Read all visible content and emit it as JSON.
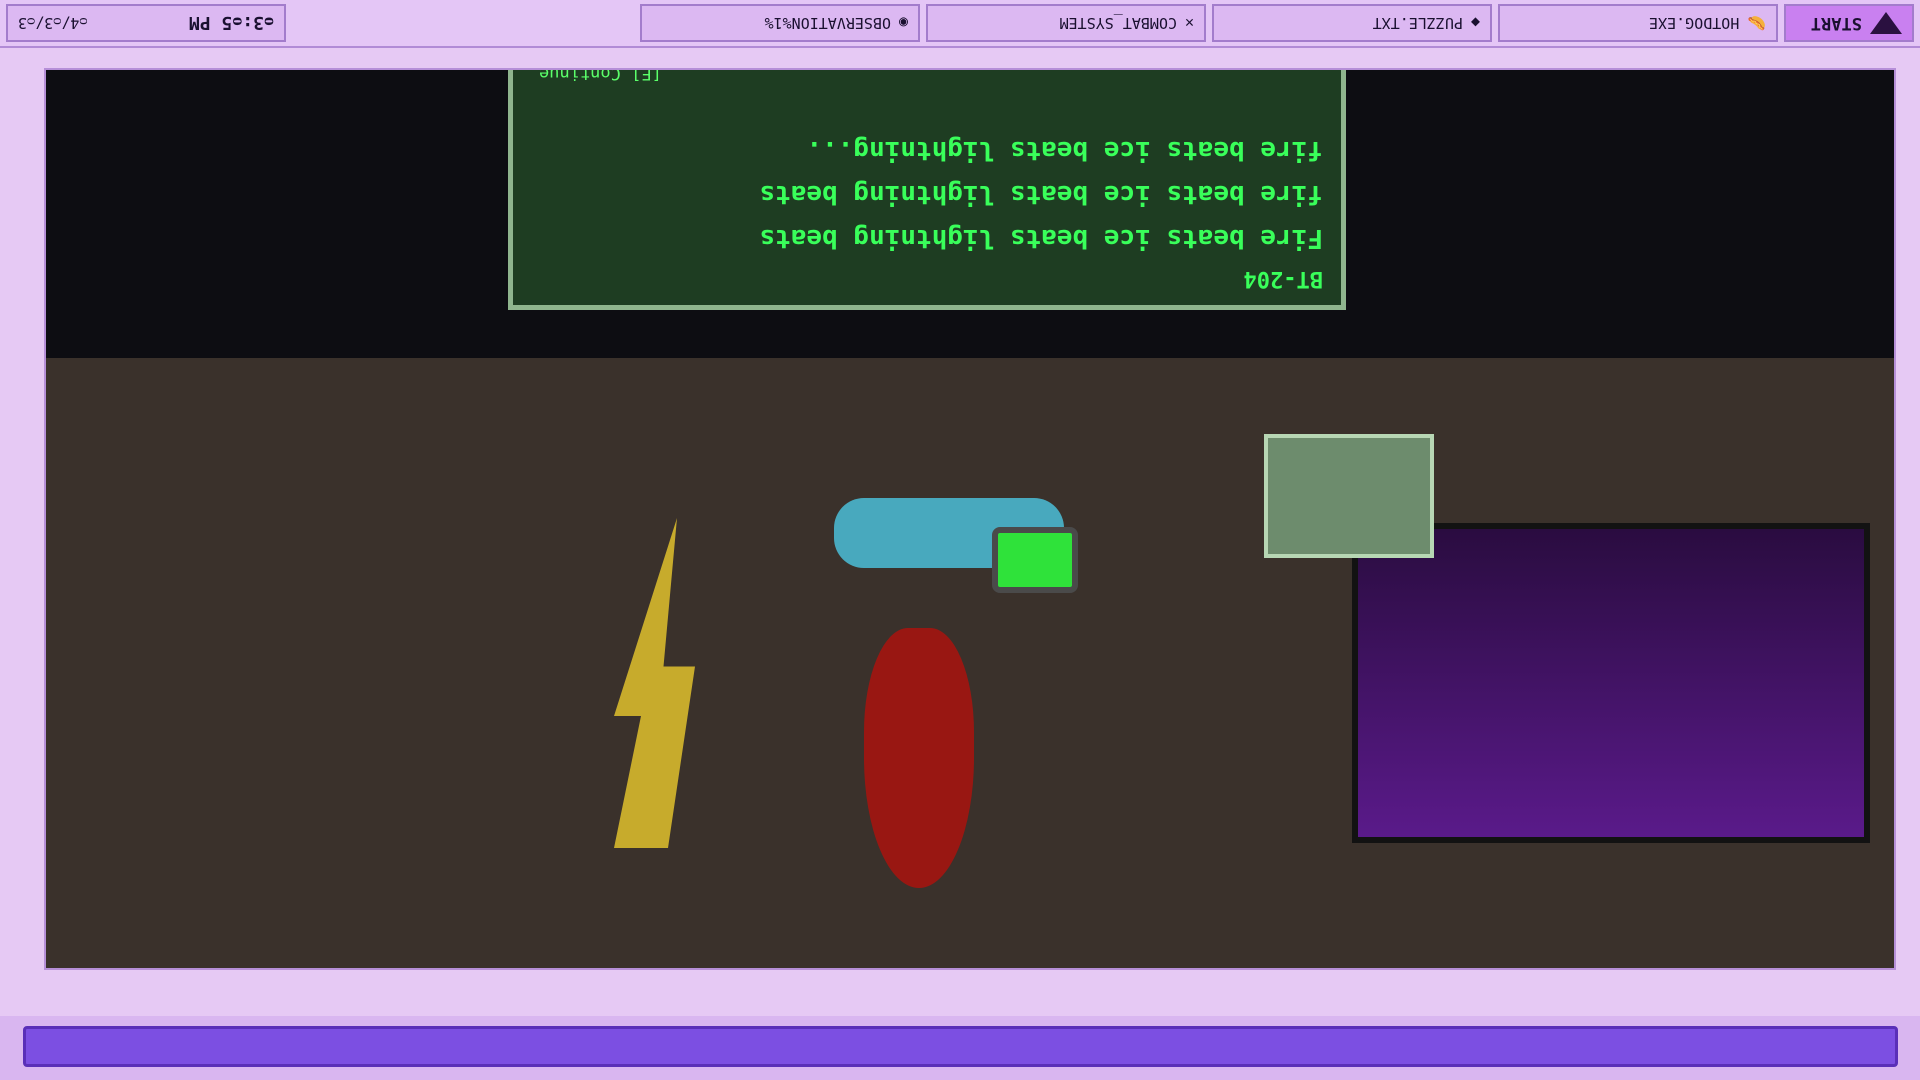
{
  "taskbar": {
    "start_label": "START",
    "apps": [
      {
        "label": "HOTDOG.EXE",
        "icon": "hotdog-icon"
      },
      {
        "label": "PUZZLE.TXT",
        "icon": "cube-icon"
      },
      {
        "label": "COMBAT_SYSTEM",
        "icon": "crossed-swords-icon"
      },
      {
        "label": "OBSERVATION%1%",
        "icon": "eye-icon"
      }
    ],
    "clock_time": "ᴑ3:ᴑ5 PM",
    "clock_date": "ᴑ4/ᴑ3/ᴑ3"
  },
  "dialog": {
    "speaker": "BT-204",
    "lines": [
      "Fire beats ice beats lightning beats",
      "fire beats ice beats lightning beats",
      "fire beats ice beats lightning..."
    ],
    "continue_hint": "[E] Continue"
  },
  "colors": {
    "accent": "#7c4fe2",
    "terminal_green": "#39ff5a",
    "taskbar": "#e4c6f6"
  }
}
